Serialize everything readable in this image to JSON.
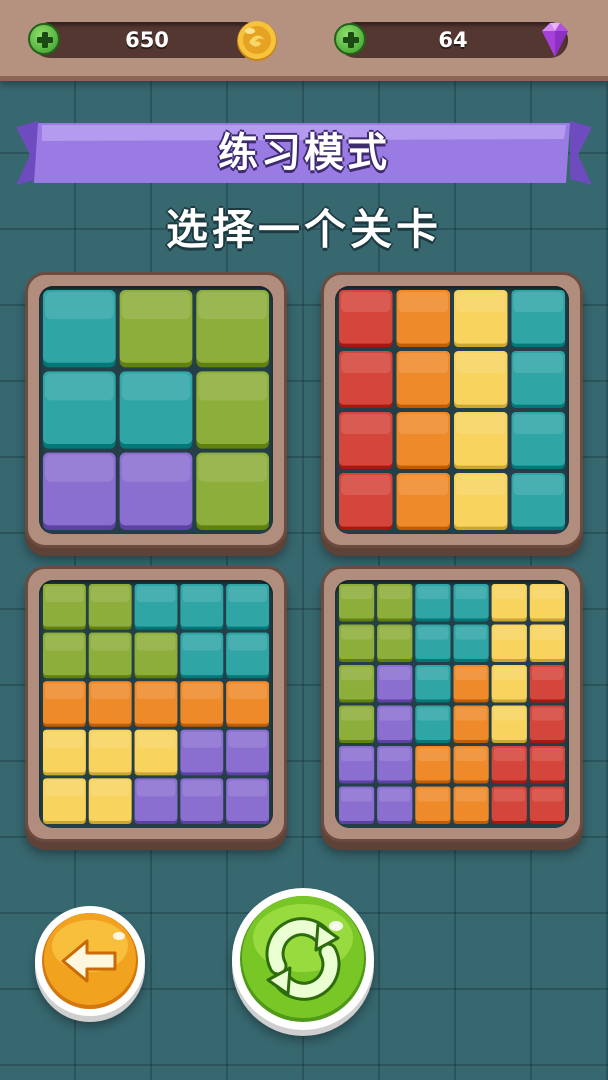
{
  "header": {
    "coins": "650",
    "gems": "64",
    "add_coins_icon": "plus-icon",
    "add_gems_icon": "plus-icon",
    "coin_icon": "gold-coin-icon",
    "gem_icon": "purple-gem-icon"
  },
  "banner": {
    "title": "练习模式",
    "subtitle": "选择一个关卡"
  },
  "colors": {
    "teal": "#2fa5a5",
    "green": "#8dae3a",
    "purple": "#8a6fd1",
    "red": "#d4453b",
    "orange": "#ee8a2a",
    "yellow": "#f8d35e"
  },
  "levels": [
    {
      "size": 3,
      "grid": [
        [
          "teal",
          "green",
          "green"
        ],
        [
          "teal",
          "teal",
          "green"
        ],
        [
          "purple",
          "purple",
          "green"
        ]
      ]
    },
    {
      "size": 4,
      "grid": [
        [
          "red",
          "orange",
          "yellow",
          "teal"
        ],
        [
          "red",
          "orange",
          "yellow",
          "teal"
        ],
        [
          "red",
          "orange",
          "yellow",
          "teal"
        ],
        [
          "red",
          "orange",
          "yellow",
          "teal"
        ]
      ]
    },
    {
      "size": 5,
      "grid": [
        [
          "green",
          "green",
          "teal",
          "teal",
          "teal"
        ],
        [
          "green",
          "green",
          "green",
          "teal",
          "teal"
        ],
        [
          "orange",
          "orange",
          "orange",
          "orange",
          "orange"
        ],
        [
          "yellow",
          "yellow",
          "yellow",
          "purple",
          "purple"
        ],
        [
          "yellow",
          "yellow",
          "purple",
          "purple",
          "purple"
        ]
      ]
    },
    {
      "size": 6,
      "grid": [
        [
          "green",
          "green",
          "teal",
          "teal",
          "yellow",
          "yellow"
        ],
        [
          "green",
          "green",
          "teal",
          "teal",
          "yellow",
          "yellow"
        ],
        [
          "green",
          "purple",
          "teal",
          "orange",
          "yellow",
          "red"
        ],
        [
          "green",
          "purple",
          "teal",
          "orange",
          "yellow",
          "red"
        ],
        [
          "purple",
          "purple",
          "orange",
          "orange",
          "red",
          "red"
        ],
        [
          "purple",
          "purple",
          "orange",
          "orange",
          "red",
          "red"
        ]
      ]
    }
  ],
  "buttons": {
    "back_icon": "back-arrow-icon",
    "restart_icon": "refresh-icon"
  }
}
